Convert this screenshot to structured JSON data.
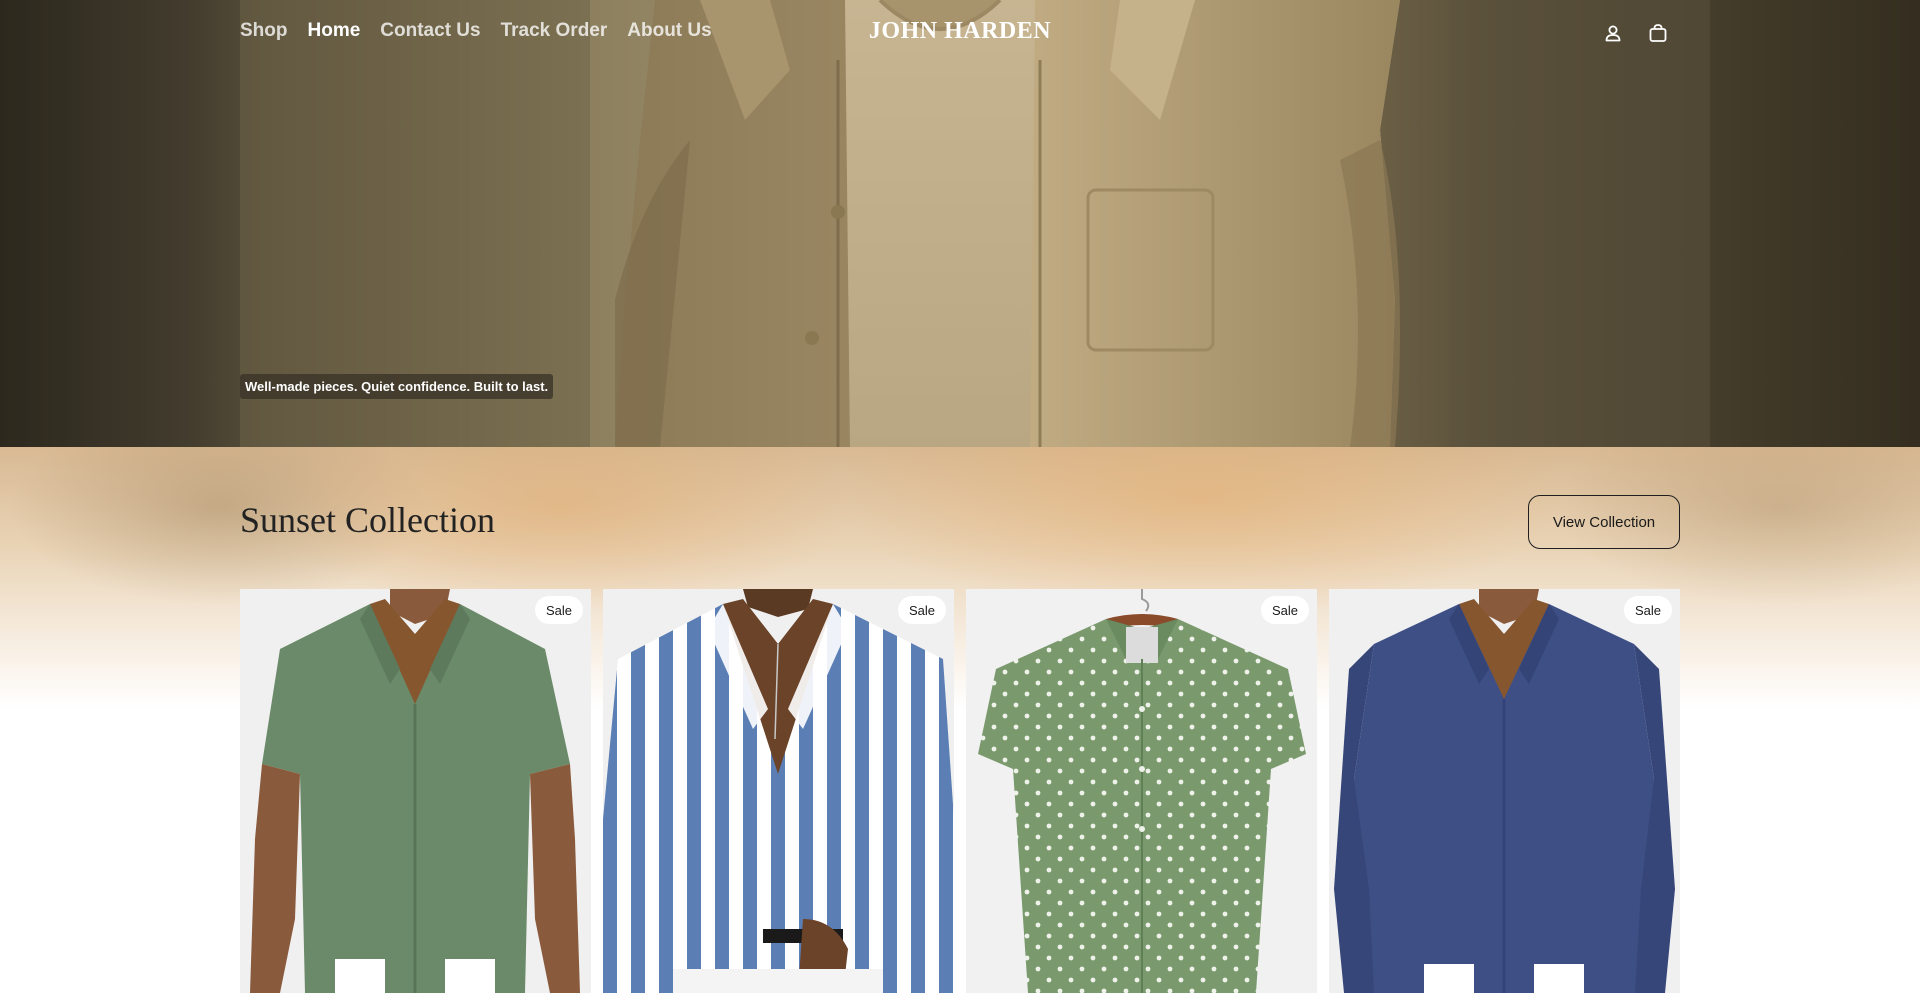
{
  "nav": {
    "links": [
      {
        "label": "Shop",
        "active": false
      },
      {
        "label": "Home",
        "active": true
      },
      {
        "label": "Contact Us",
        "active": false
      },
      {
        "label": "Track Order",
        "active": false
      },
      {
        "label": "About Us",
        "active": false
      }
    ],
    "brand": "JOHN HARDEN",
    "icons": [
      "account-icon",
      "bag-icon"
    ]
  },
  "hero": {
    "tagline": "Well-made pieces. Quiet confidence. Built to last."
  },
  "collection": {
    "title": "Sunset Collection",
    "view_button": "View Collection",
    "products": [
      {
        "badge": "Sale",
        "image": "green short-sleeve linen shirt",
        "color": "#6b8a6a"
      },
      {
        "badge": "Sale",
        "image": "blue and white striped shirt",
        "color": "#5b7fb5"
      },
      {
        "badge": "Sale",
        "image": "green polka dot short-sleeve shirt",
        "color": "#7a9a6e"
      },
      {
        "badge": "Sale",
        "image": "navy long-sleeve linen shirt",
        "color": "#3e4f86"
      }
    ]
  }
}
